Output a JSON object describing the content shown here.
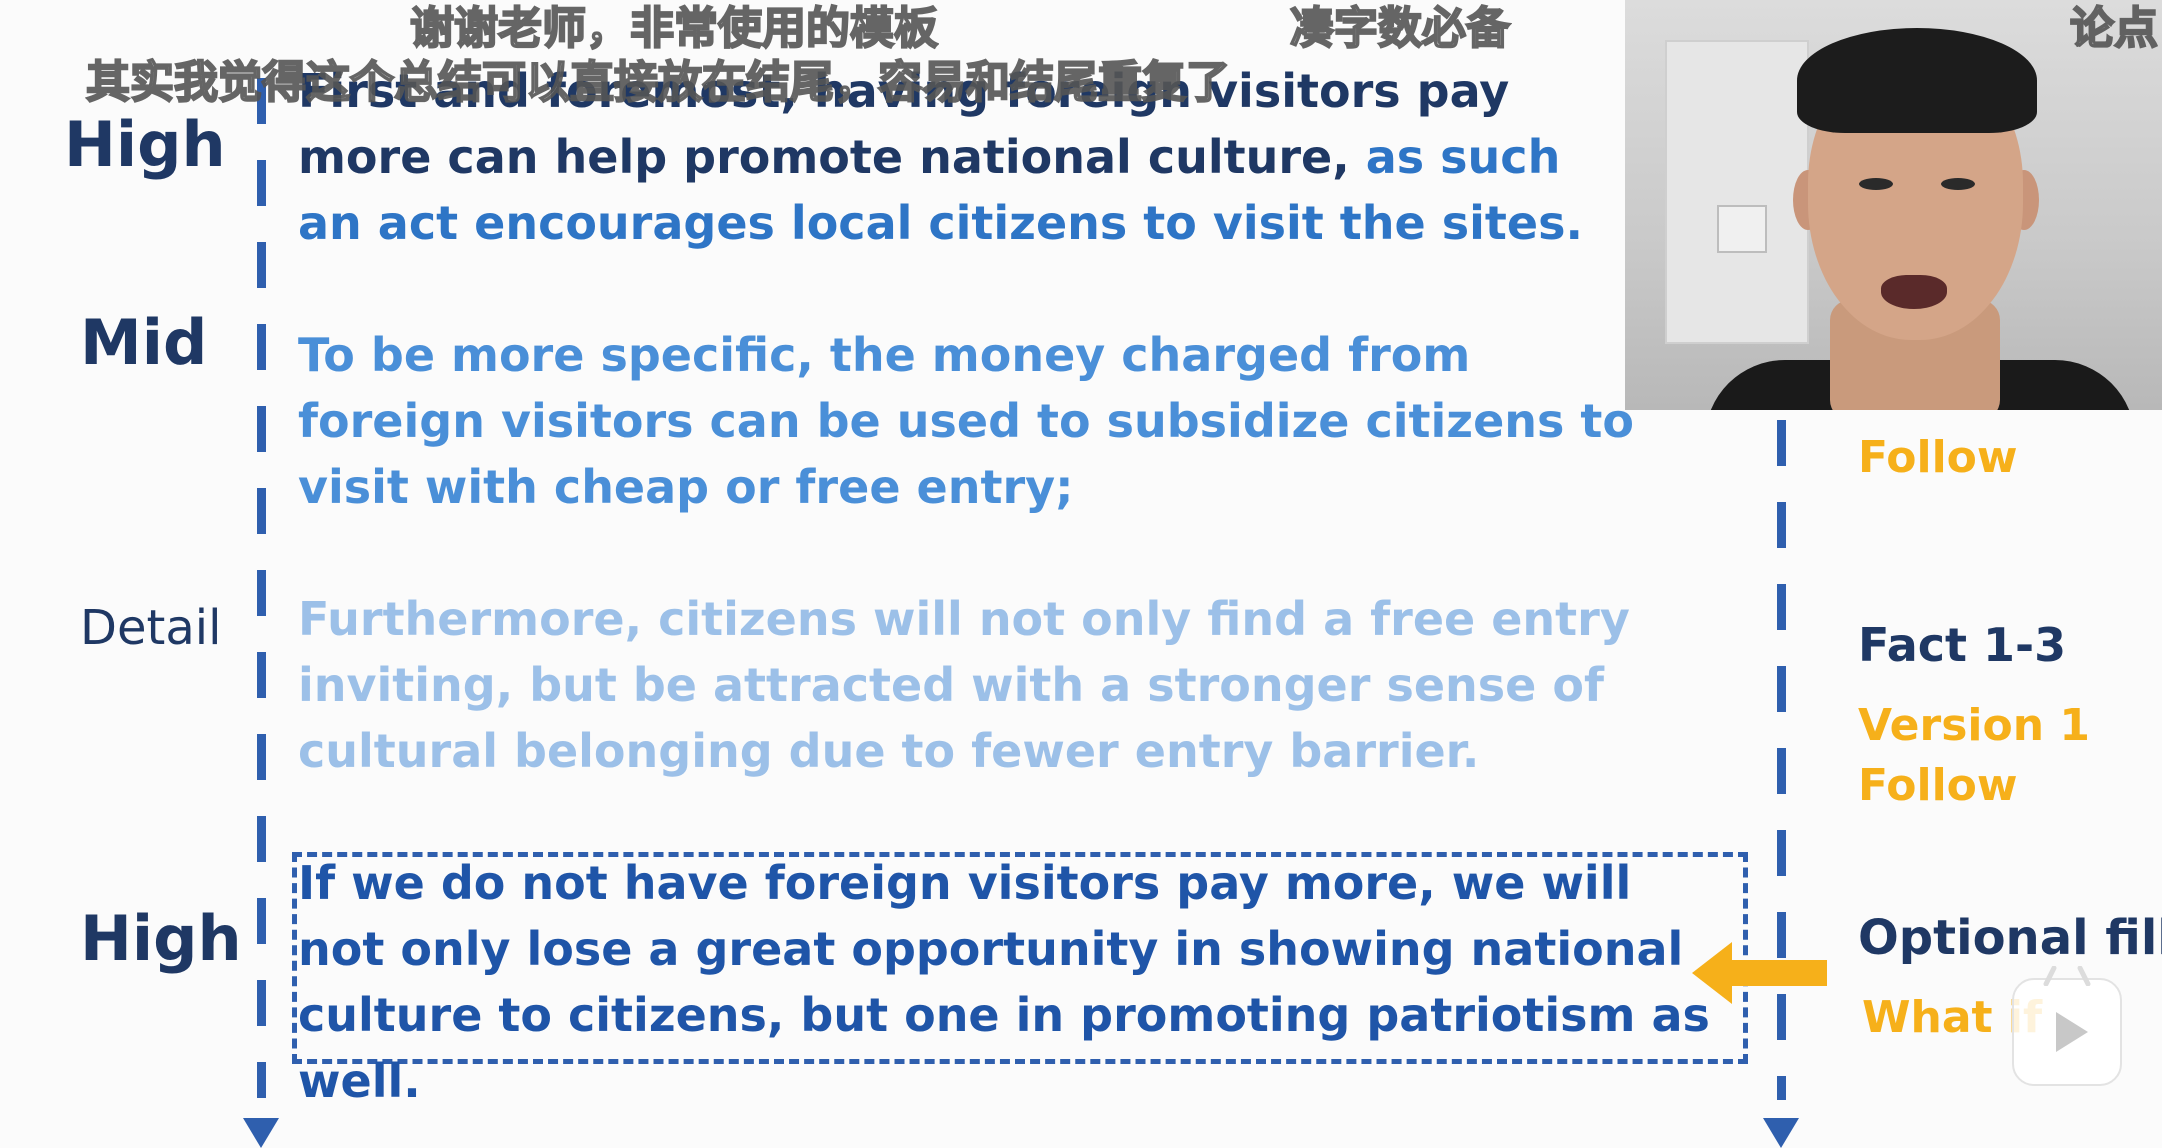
{
  "subtitles": {
    "line1_left": "谢谢老师，非常使用的模板",
    "line1_mid": "凑字数必备",
    "line1_right": "论点",
    "line2": "其实我觉得这个总结可以直接放在结尾，容易和结尾重复了"
  },
  "levels": {
    "high1": "High",
    "mid": "Mid",
    "detail": "Detail",
    "high2": "High"
  },
  "paragraphs": {
    "p1_dark": "First and foremost, having foreign visitors pay more can help promote national culture, ",
    "p1_blue": "as such an act encourages local citizens to visit the sites.",
    "p2": "To be more specific, the money charged from foreign visitors can be used to subsidize citizens to visit with cheap or free entry;",
    "p3": "Furthermore, citizens will not only find a free entry inviting, but be attracted with a stronger sense of cultural belonging due to fewer entry barrier.",
    "p4": "If we do not have foreign visitors pay more, we will not only lose a great opportunity in showing national culture to citizens, but one in promoting patriotism as well."
  },
  "right_column": {
    "follow1": "Follow",
    "fact": "Fact 1-3",
    "version": "Version 1",
    "follow2": "Follow",
    "optional": "Optional filler",
    "whatif": "What if"
  },
  "colors": {
    "dark_navy": "#1f3864",
    "mid_blue": "#4a8fd8",
    "light_blue": "#9cc0e8",
    "accent_yellow": "#f6b01a",
    "line_blue": "#2f5fae"
  }
}
